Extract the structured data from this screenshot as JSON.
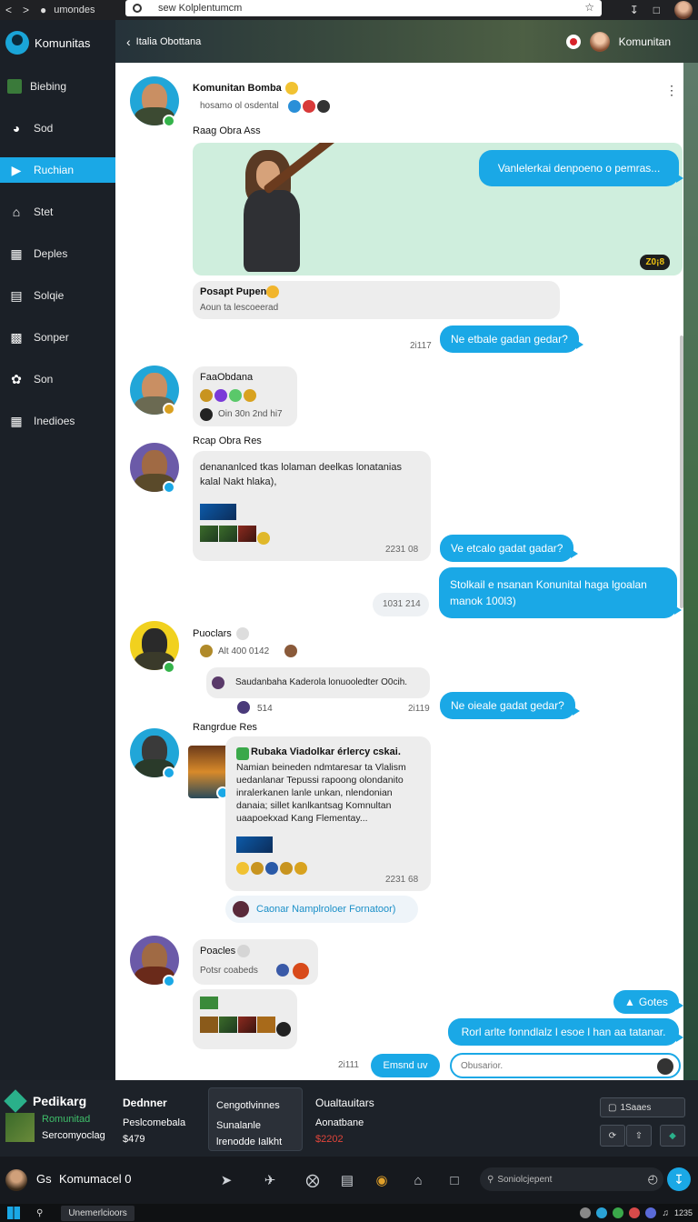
{
  "browser": {
    "tab_title": "umondes",
    "url": "sew Kolplentumcm"
  },
  "sidebar": {
    "brand": "Komunitas",
    "items": [
      {
        "label": "Biebing"
      },
      {
        "label": "Sod"
      },
      {
        "label": "Ruchian"
      },
      {
        "label": "Stet"
      },
      {
        "label": "Deples"
      },
      {
        "label": "Solqie"
      },
      {
        "label": "Sonper"
      },
      {
        "label": "Son"
      },
      {
        "label": "Inedioes"
      }
    ]
  },
  "header": {
    "title": "Italia Obottana",
    "right_label": "Komunitan"
  },
  "chat": {
    "m1": {
      "name": "Komunitan Bomba",
      "status": "hosamo ol osdental",
      "caption": "Raag Obra Ass",
      "media_bubble": "Vanlelerkai denpoeno o pemras...",
      "media_tag": "Z0¡8",
      "quote_title": "Posapt Pupeno",
      "quote_sub": "Aoun ta lescoeerad"
    },
    "o1": {
      "text": "Ne etbale gadan gedar?",
      "time": "2i117"
    },
    "m2": {
      "name": "FaaObdana",
      "status": "Oin 30n 2nd hi7"
    },
    "m3": {
      "caption": "Rcap Obra Res",
      "text": "denananlced tkas lolaman deelkas lonatanias kalal Nakt hlaka),",
      "time": "2231 08"
    },
    "o2": {
      "text": "Ve etcalo gadat gadar?"
    },
    "o3": {
      "text": "Stolkail e nsanan Konunital haga lgoalan manok 100l3)"
    },
    "ts_mid": "1031 214",
    "m4": {
      "name": "Puoclars",
      "status": "Alt 400 0142",
      "reply": "Saudanbaha Kaderola lonuooledter O0cih.",
      "meta": "514",
      "time": "2i119"
    },
    "o4": {
      "text": "Ne oieale gadat gedar?"
    },
    "m5": {
      "caption": "Rangrdue Res",
      "title": "Rubaka Viadolkar érlercy cskai.",
      "body": "Namian beineden ndmtaresar ta Vlalism uedanlanar Tepussi rapoong olondanito inralerkanen lanle unkan, nlendonian danaia; sillet kanlkantsag Komnultan uaapoekxad Kang Flementay...",
      "time": "2231 68",
      "pill": "Caonar Namplroloer Fornatoor)"
    },
    "m6": {
      "name": "Poacles",
      "status": "Potsr coabeds"
    },
    "o5": {
      "text": "Gotes"
    },
    "o6": {
      "text": "Rorl arlte fonndlalz l esoe l han aa tatanar."
    },
    "compose": {
      "time": "2i111",
      "send_label": "Emsnd uv",
      "placeholder": "Obusarior."
    }
  },
  "widgets": {
    "brand": "Pedikarg",
    "brand_sub1": "Romunitad",
    "brand_sub2": "Sercomyoclag",
    "c1_h": "Dednner",
    "c1_a": "Peslcomebala",
    "c1_b": "$479",
    "c2_h": "Cengotlvinnes",
    "c2_a": "Sunalanle",
    "c2_b": "lrenodde Ialkht",
    "c3_h": "Oualtauitars",
    "c3_a": "Aonatbane",
    "c3_b": "$2202",
    "btn_label": "1Saaes"
  },
  "taskbar": {
    "user": "Gs",
    "label": "Komumacel 0",
    "search_placeholder": "Soniolcjepent"
  },
  "os": {
    "app": "Unemerlcioors",
    "clock": "1235"
  }
}
